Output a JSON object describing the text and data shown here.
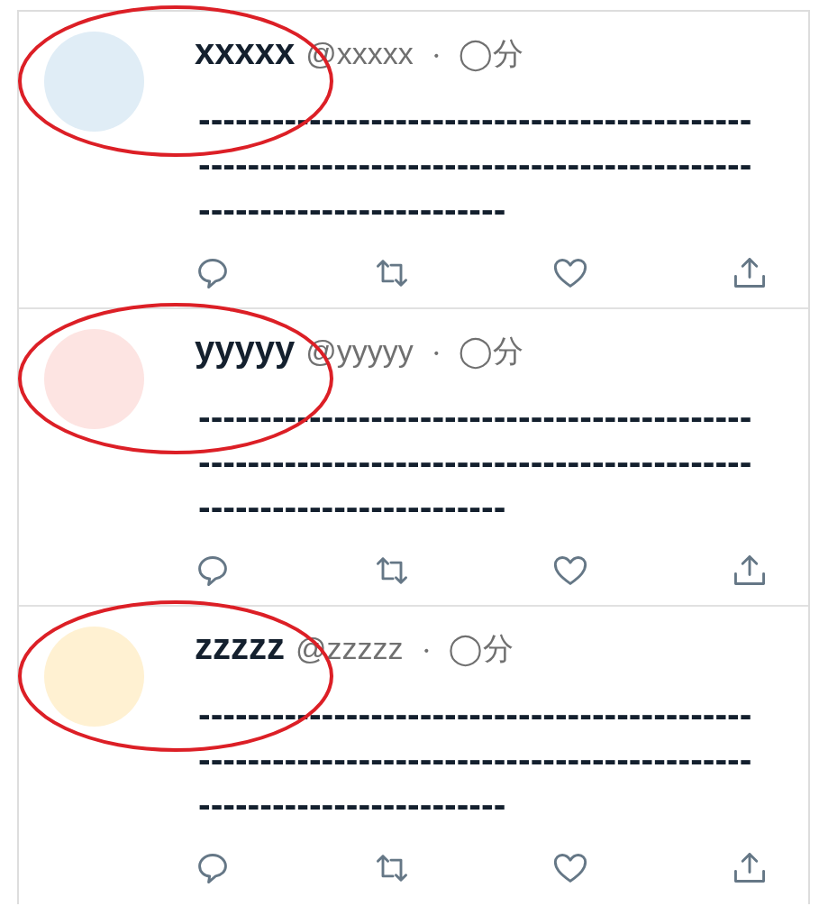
{
  "tweets": [
    {
      "color": "#e0edf6",
      "name": "xxxxx",
      "handle": "@xxxxx",
      "separator": "・",
      "time": "◯分",
      "highlighted": true,
      "body": [
        "---------------------------------------------",
        "---------------------------------------------",
        "-------------------------"
      ]
    },
    {
      "color": "#fde4e2",
      "name": "yyyyy",
      "handle": "@yyyyy",
      "separator": "・",
      "time": "◯分",
      "highlighted": true,
      "body": [
        "---------------------------------------------",
        "---------------------------------------------",
        "-------------------------"
      ]
    },
    {
      "color": "#fff1d2",
      "name": "zzzzz",
      "handle": "@zzzzz",
      "separator": "・",
      "time": "◯分",
      "highlighted": true,
      "body": [
        "---------------------------------------------",
        "---------------------------------------------",
        "-------------------------"
      ]
    }
  ]
}
